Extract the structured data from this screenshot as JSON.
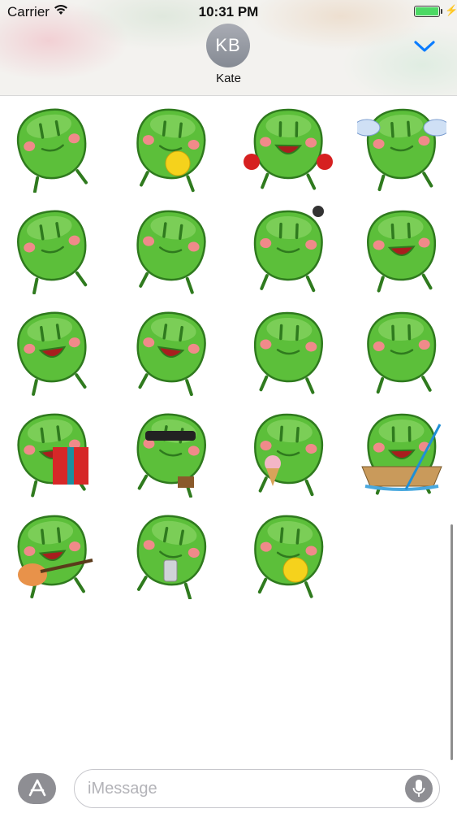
{
  "status_bar": {
    "carrier": "Carrier",
    "time": "10:31 PM",
    "battery_level": 1.0
  },
  "conversation": {
    "avatar_initials": "KB",
    "contact_name": "Kate"
  },
  "colors": {
    "frog_green": "#5cbf3a",
    "frog_dark": "#2f7a1e",
    "cheek_pink": "#f08a8a",
    "ios_blue": "#0a7cff",
    "battery_green": "#4cd964"
  },
  "stickers": [
    {
      "name": "frog-balloon"
    },
    {
      "name": "frog-emoji-ball"
    },
    {
      "name": "frog-boxing"
    },
    {
      "name": "frog-angel"
    },
    {
      "name": "frog-shy"
    },
    {
      "name": "frog-grumpy"
    },
    {
      "name": "frog-strong"
    },
    {
      "name": "frog-crying"
    },
    {
      "name": "frog-cheering"
    },
    {
      "name": "frog-sad"
    },
    {
      "name": "frog-shrug"
    },
    {
      "name": "frog-dancing"
    },
    {
      "name": "frog-gift"
    },
    {
      "name": "frog-sunglasses"
    },
    {
      "name": "frog-ice-cream"
    },
    {
      "name": "frog-boat"
    },
    {
      "name": "frog-guitar"
    },
    {
      "name": "frog-phone"
    },
    {
      "name": "frog-wink-ball"
    }
  ],
  "input_bar": {
    "placeholder": "iMessage",
    "appstore_icon": "app-store-icon",
    "mic_icon": "microphone-icon"
  }
}
